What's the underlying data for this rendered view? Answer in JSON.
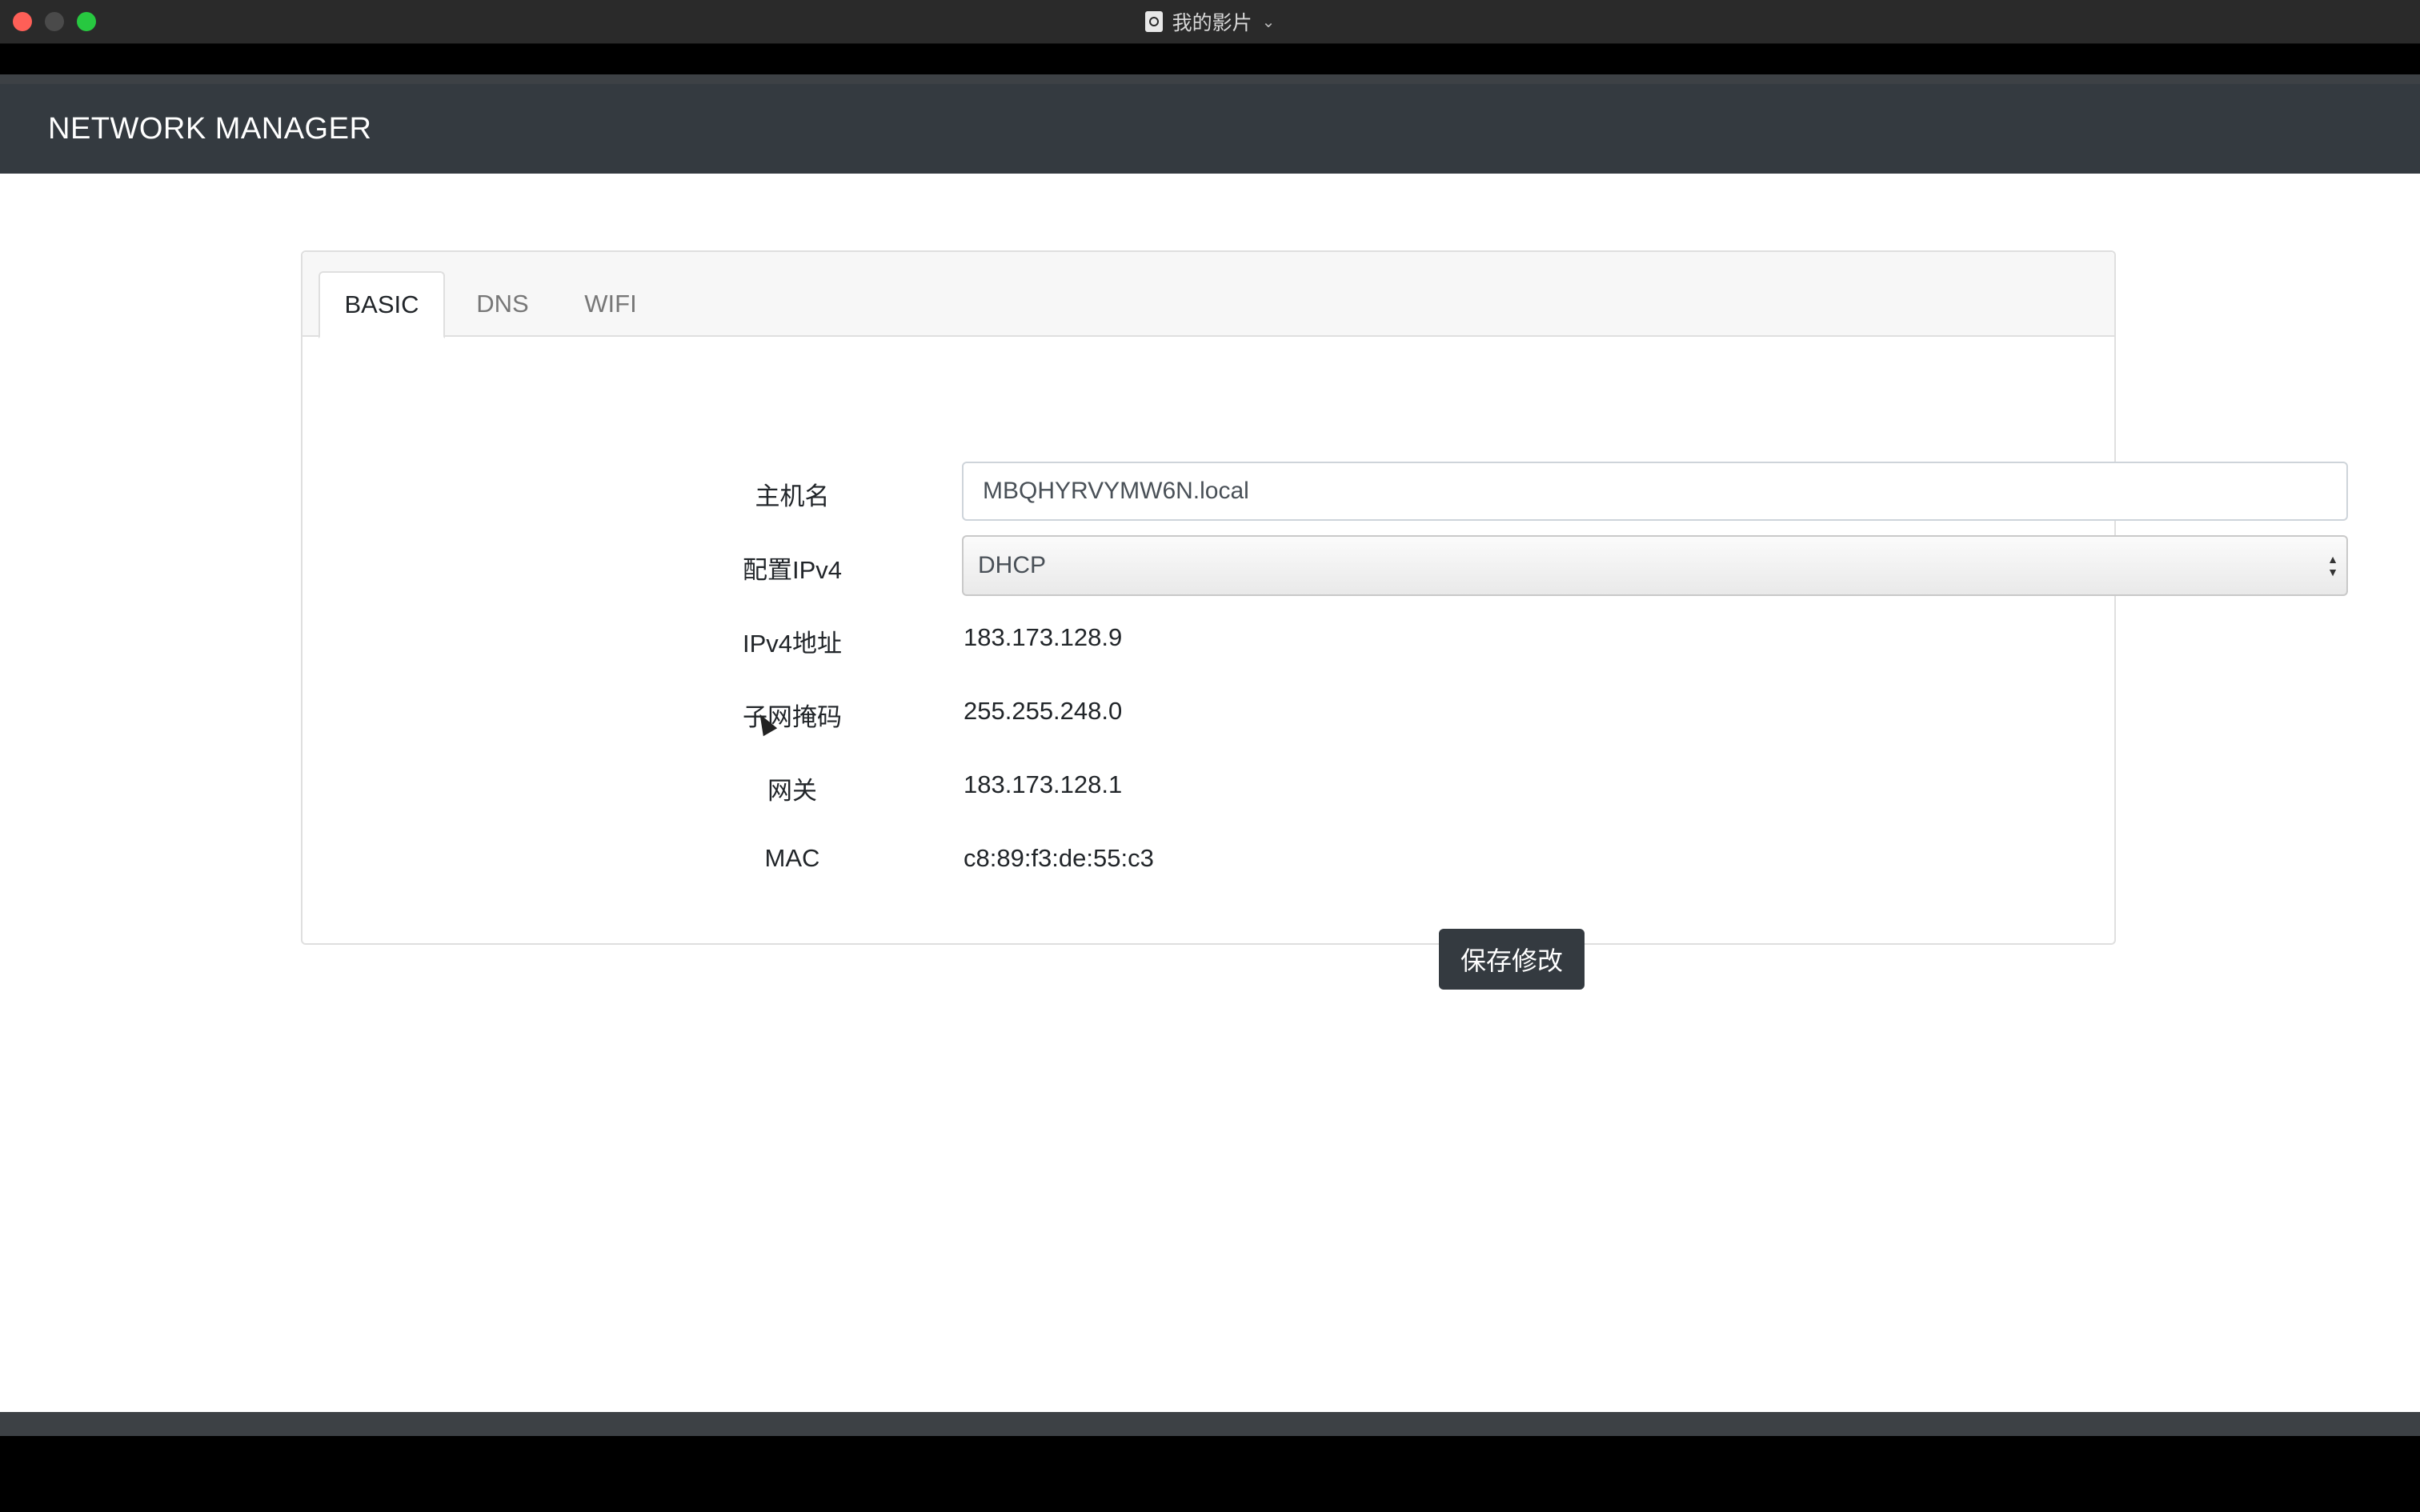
{
  "window": {
    "title": "我的影片"
  },
  "navbar": {
    "brand": "NETWORK MANAGER"
  },
  "tabs": [
    {
      "label": "BASIC",
      "active": true
    },
    {
      "label": "DNS",
      "active": false
    },
    {
      "label": "WIFI",
      "active": false
    }
  ],
  "form": {
    "hostname": {
      "label": "主机名",
      "value": "MBQHYRVYMW6N.local"
    },
    "ipv4_config": {
      "label": "配置IPv4",
      "selected": "DHCP"
    },
    "ipv4_address": {
      "label": "IPv4地址",
      "value": "183.173.128.9"
    },
    "subnet_mask": {
      "label": "子网掩码",
      "value": "255.255.248.0"
    },
    "gateway": {
      "label": "网关",
      "value": "183.173.128.1"
    },
    "mac": {
      "label": "MAC",
      "value": "c8:89:f3:de:55:c3"
    },
    "save_label": "保存修改"
  },
  "colors": {
    "navbar": "#343a40",
    "button": "#343a40",
    "close": "#fe5f57",
    "zoom": "#27c840"
  }
}
